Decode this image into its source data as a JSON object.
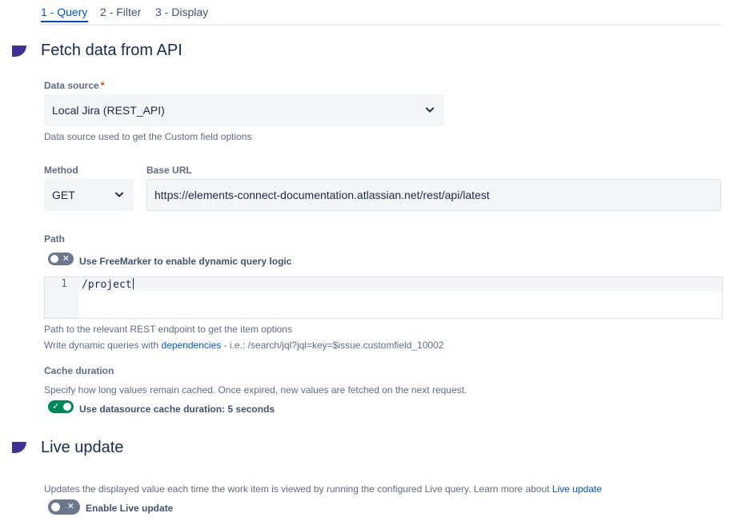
{
  "tabs": [
    {
      "label": "1 - Query",
      "active": true
    },
    {
      "label": "2 - Filter",
      "active": false
    },
    {
      "label": "3 - Display",
      "active": false
    }
  ],
  "fetch_section": {
    "title": "Fetch data from API",
    "data_source": {
      "label": "Data source",
      "required_mark": "*",
      "value": "Local Jira (REST_API)",
      "help": "Data source used to get the Custom field options"
    },
    "method": {
      "label": "Method",
      "value": "GET"
    },
    "base_url": {
      "label": "Base URL",
      "value": "https://elements-connect-documentation.atlassian.net/rest/api/latest"
    },
    "path": {
      "label": "Path",
      "freemarker_toggle": {
        "label": "Use FreeMarker to enable dynamic query logic",
        "on": false
      },
      "editor": {
        "line_number": "1",
        "code": "/project"
      },
      "help_line1": "Path to the relevant REST endpoint to get the item options",
      "help_line2_prefix": "Write dynamic queries with",
      "help_line2_link": "dependencies",
      "help_line2_suffix": " - i.e.: /search/jql?jql=key=$issue.customfield_10002"
    },
    "cache": {
      "label": "Cache duration",
      "help": "Specify how long values remain cached. Once expired, new values are fetched on the next request.",
      "toggle": {
        "label": "Use datasource cache duration: 5 seconds",
        "on": true
      }
    }
  },
  "live_section": {
    "title": "Live update",
    "help_prefix": "Updates the displayed value each time the work item is viewed by running the configured Live query. Learn more about",
    "help_link": "Live update",
    "toggle": {
      "label": "Enable Live update",
      "on": false
    }
  },
  "icons": {
    "toggle_off_glyph": "✕",
    "toggle_on_glyph": "✓"
  },
  "colors": {
    "accent": "#0052cc",
    "section_marker": "#403294",
    "toggle_on": "#00875a",
    "toggle_off": "#6b778c",
    "required": "#de350b"
  }
}
